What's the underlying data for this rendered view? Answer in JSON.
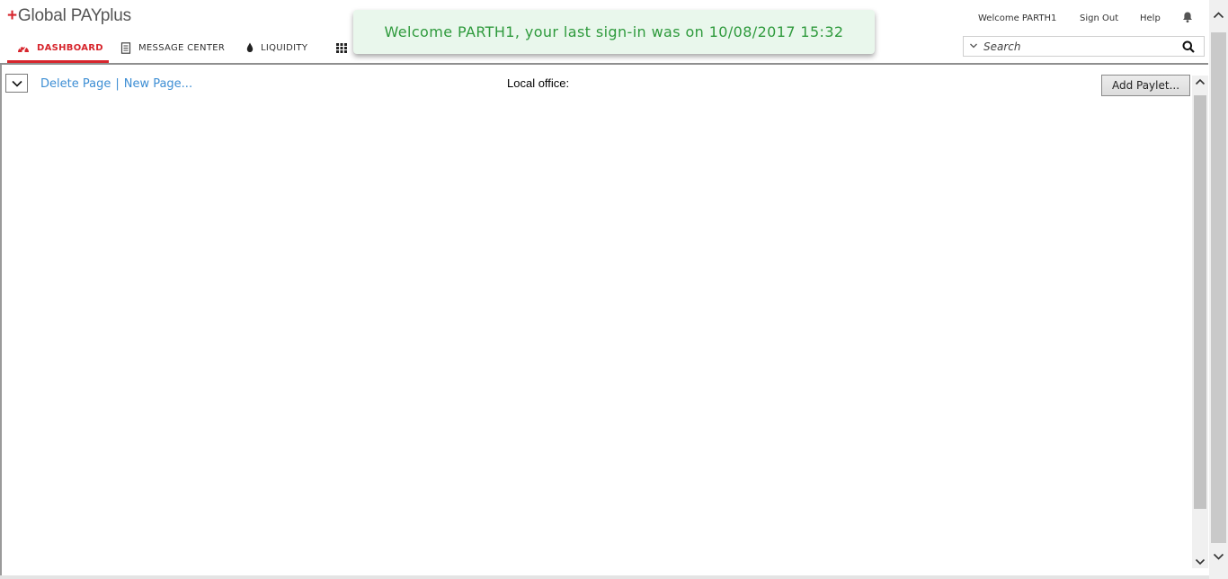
{
  "app": {
    "logo_plus": "+",
    "logo_text": "Global PAYplus"
  },
  "header": {
    "welcome": "Welcome PARTH1",
    "sign_out": "Sign Out",
    "help": "Help",
    "bell_icon": "bell-icon"
  },
  "nav": {
    "items": [
      {
        "label": "DASHBOARD",
        "icon": "dashboard-gauge-icon",
        "active": true
      },
      {
        "label": "MESSAGE CENTER",
        "icon": "document-icon",
        "active": false
      },
      {
        "label": "LIQUIDITY",
        "icon": "drop-icon",
        "active": false
      },
      {
        "label": "",
        "icon": "grid-apps-icon",
        "active": false
      }
    ]
  },
  "search": {
    "placeholder": "Search",
    "value": ""
  },
  "toolbar": {
    "delete_page": "Delete Page",
    "separator": "|",
    "new_page": "New Page...",
    "local_office_label": "Local office:",
    "add_paylet": "Add Paylet..."
  },
  "toast": {
    "message": "Welcome PARTH1, your last sign-in was on 10/08/2017 15:32"
  },
  "colors": {
    "brand_red": "#d7262d",
    "link_blue": "#3d8ed4",
    "toast_green": "#2e9a3c",
    "toast_bg": "#e9f7ec"
  }
}
